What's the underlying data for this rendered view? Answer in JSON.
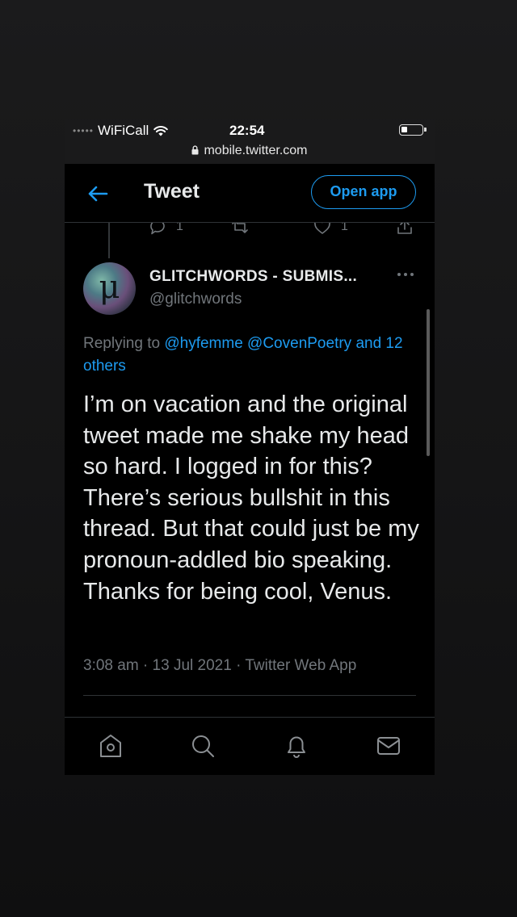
{
  "status_bar": {
    "carrier_dots": "•••••",
    "carrier": "WiFiCall",
    "time": "22:54",
    "url": "mobile.twitter.com"
  },
  "header": {
    "title": "Tweet",
    "open_app_label": "Open app"
  },
  "previous_tweet_actions": {
    "reply_count": "1",
    "like_count": "1"
  },
  "tweet": {
    "avatar_letter": "μ",
    "display_name": "GLITCHWORDS - SUBMIS...",
    "handle": "@glitchwords",
    "replying_prefix": "Replying to",
    "mentions": [
      "@hyfemme",
      "@CovenPoetry"
    ],
    "and_others": "and 12 others",
    "text": "I’m on vacation and the original tweet made me shake my head so hard. I logged in for this? There’s serious bullshit in this thread. But that could just be my pronoun-addled bio speaking. Thanks for being cool, Venus.",
    "meta": "3:08 am · 13 Jul 2021 · Twitter Web App"
  },
  "tabbar": {
    "items": [
      "home-icon",
      "search-icon",
      "notifications-icon",
      "messages-icon"
    ]
  },
  "colors": {
    "accent": "#1d9bf0",
    "text_primary": "#e7e9ea",
    "text_secondary": "#71767b",
    "background": "#000000"
  }
}
